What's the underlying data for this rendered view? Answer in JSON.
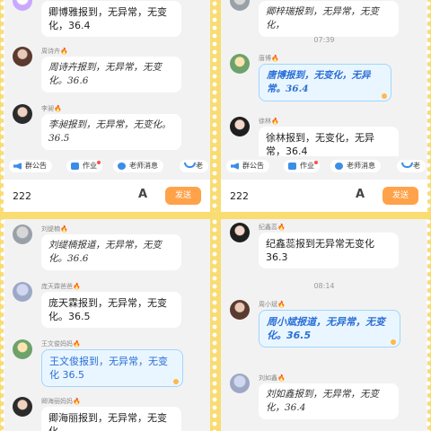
{
  "tl": {
    "msg0_text": "卿博雅报到，无异常，无变化，36.4",
    "msg1_name": "周诗卉",
    "msg1_text": "周诗卉报到，无异常，无变化。36.6",
    "msg2_name": "李昶",
    "msg2_text": "李昶报到，无异常，无变化。36.5",
    "toolbar": {
      "notice": "群公告",
      "homework": "作业",
      "teacher_msg": "老师消息",
      "more": "老"
    },
    "input_value": "222",
    "font_icon": "A",
    "send_label": "发送"
  },
  "tr": {
    "msg0_text": "卿梓瑞报到，无异常，无变化，",
    "time": "07:39",
    "msg1_name": "唐博",
    "msg1_text": "唐博报到，无变化，无异常。36.4",
    "msg2_name": "徐林",
    "msg2_text": "徐林报到，无变化，无异常，36.4",
    "toolbar": {
      "notice": "群公告",
      "homework": "作业",
      "teacher_msg": "老师消息",
      "more": "老"
    },
    "input_value": "222",
    "font_icon": "A",
    "send_label": "发送"
  },
  "bl": {
    "msg1_name": "刘缇楠",
    "msg1_text": "刘缇楠报道，无异常，无变化。36.6",
    "msg2_name": "庞天霖爸爸",
    "msg2_text": "庞天霖报到，无异常，无变化。36.5",
    "msg3_name": "王文俊妈妈",
    "msg3_text": "王文俊报到，无异常，无变化 36.5",
    "msg4_name": "卿海丽妈妈",
    "msg4_text": "卿海丽报到，无异常，无变化，"
  },
  "br": {
    "msg1_name": "纪鑫蕊",
    "msg1_text": "纪鑫蕊报到无异常无变化36.3",
    "time": "08:14",
    "msg2_name": "周小斌",
    "msg2_text": "周小斌报道，无异常，无变化。36.5",
    "msg3_name": "刘如鑫",
    "msg3_text": "刘如鑫报到，无异常，无变化，36.4"
  },
  "fire_icon": "🔥"
}
